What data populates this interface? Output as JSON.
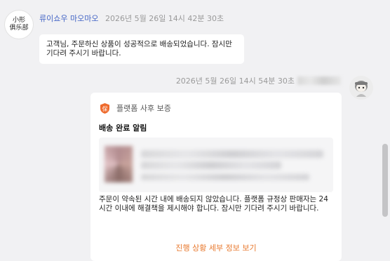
{
  "store": {
    "avatar_line1": "小形",
    "avatar_line2": "俱乐部"
  },
  "messages": [
    {
      "sender": "류이쇼우 마오마오",
      "time": "2026년 5월 26일 14시 42분 30초",
      "text": "고객님, 주문하신 상품이 성공적으로 배송되었습니다. 잠시만 기다려 주시기 바랍니다."
    },
    {
      "time": "2026년 5월 26일 14시 54분 30초"
    }
  ],
  "card": {
    "header": "플랫폼 사후 보증",
    "shield_icon_char": "保",
    "title": "배송 완료 알림",
    "body": "주문이 약속된 시간 내에 배송되지 않았습니다. 플랫폼 규정상 판매자는 24시간 이내에 해결책을 제시해야 합니다. 잠시만 기다려 주시기 바랍니다.",
    "link": "진행 상황 세부 정보 보기"
  },
  "colors": {
    "accent": "#e8792e",
    "sender_name": "#4566c6",
    "background": "#f1f1f3"
  }
}
